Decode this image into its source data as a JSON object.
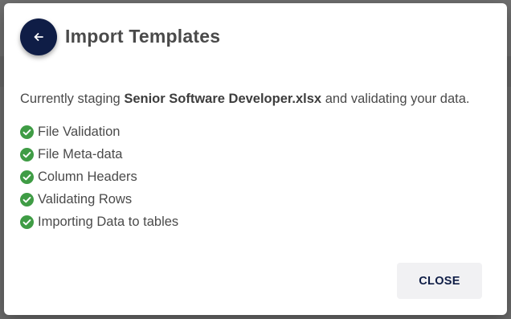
{
  "dialog": {
    "title": "Import Templates",
    "back_icon": "arrow-left-icon",
    "staging": {
      "prefix": "Currently staging",
      "filename": "Senior Software Developer.xlsx",
      "suffix": "and validating your data."
    },
    "steps": [
      {
        "label": "File Validation",
        "status": "complete"
      },
      {
        "label": "File Meta-data",
        "status": "complete"
      },
      {
        "label": "Column Headers",
        "status": "complete"
      },
      {
        "label": "Validating Rows",
        "status": "complete"
      },
      {
        "label": "Importing Data to tables",
        "status": "complete"
      }
    ],
    "close_label": "CLOSE"
  },
  "colors": {
    "accent": "#0f1d46",
    "success": "#3f9c45",
    "text": "#4a4a4a",
    "button_bg": "#f1f1f3"
  }
}
